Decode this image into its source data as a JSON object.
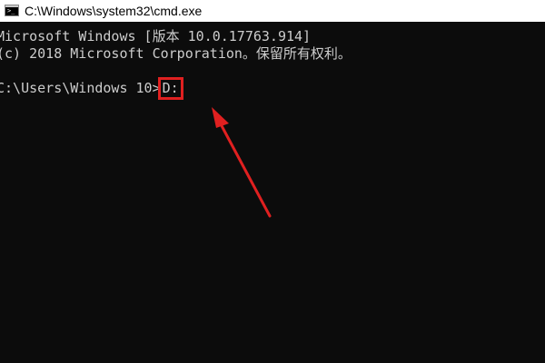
{
  "window": {
    "title": "C:\\Windows\\system32\\cmd.exe",
    "icon": "cmd-icon"
  },
  "console": {
    "line1": "Microsoft Windows [版本 10.0.17763.914]",
    "line2": "(c) 2018 Microsoft Corporation。保留所有权利。",
    "prompt": "C:\\Users\\Windows 10>",
    "typed_command": "D:"
  },
  "annotation": {
    "highlight_color": "#e02020",
    "arrow_color": "#e02020",
    "arrow_target": "typed-command"
  },
  "colors": {
    "console_background": "#0c0c0c",
    "console_text": "#cccccc",
    "titlebar_background": "#ffffff"
  }
}
